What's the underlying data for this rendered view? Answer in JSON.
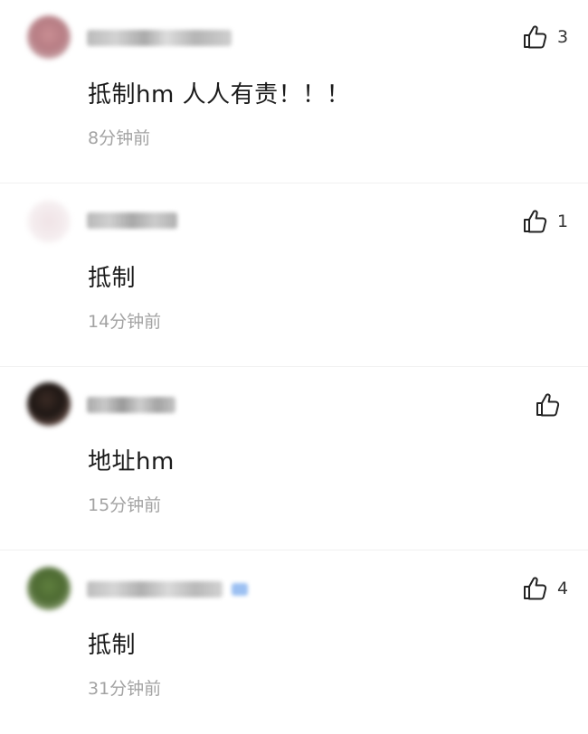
{
  "comments": [
    {
      "text": "抵制hm 人人有责！！！",
      "time": "8分钟前",
      "likes": "3"
    },
    {
      "text": "抵制",
      "time": "14分钟前",
      "likes": "1"
    },
    {
      "text": "地址hm",
      "time": "15分钟前",
      "likes": ""
    },
    {
      "text": "抵制",
      "time": "31分钟前",
      "likes": "4"
    }
  ],
  "icons": {
    "like": "thumbs-up-icon"
  }
}
